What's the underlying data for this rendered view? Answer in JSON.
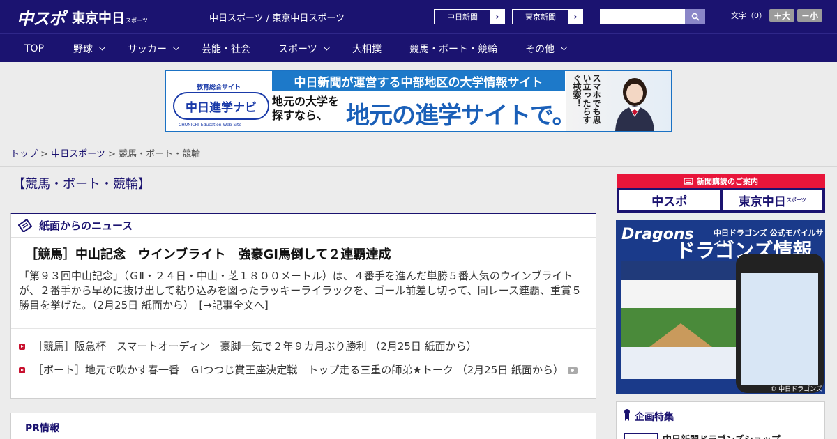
{
  "header": {
    "logo_main": "中スポ",
    "logo_sub": "東京中日",
    "logo_sub_small": "スポーツ",
    "tagline": "中日スポーツ / 東京中日スポーツ",
    "site_links": [
      {
        "label": "中日新聞"
      },
      {
        "label": "東京新聞"
      }
    ],
    "search_placeholder": "",
    "font_size_label": "文字（0）",
    "font_larger": "＋大",
    "font_smaller": "－小"
  },
  "nav": [
    {
      "label": "TOP",
      "has_dropdown": false
    },
    {
      "label": "野球",
      "has_dropdown": true
    },
    {
      "label": "サッカー",
      "has_dropdown": true
    },
    {
      "label": "芸能・社会",
      "has_dropdown": false
    },
    {
      "label": "スポーツ",
      "has_dropdown": true
    },
    {
      "label": "大相撲",
      "has_dropdown": false
    },
    {
      "label": "競馬・ボート・競輪",
      "has_dropdown": false
    },
    {
      "label": "その他",
      "has_dropdown": true
    }
  ],
  "ad_banner": {
    "brand_top": "教育総合サイト",
    "brand_name": "中日進学ナビ",
    "brand_en": "CHUNICHI Education Web Site",
    "headline": "中日新聞が運営する中部地区の大学情報サイト",
    "sub_line1": "地元の大学を",
    "sub_line2": "探すなら、",
    "big_text": "地元の進学サイトで。",
    "vertical_text": "スマホでも思い立ったらすぐ検索！"
  },
  "breadcrumb": {
    "home": "トップ",
    "section": "中日スポーツ",
    "current": "競馬・ボート・競輪",
    "separator": ">"
  },
  "page_title": "【競馬・ボート・競輪】",
  "news": {
    "heading": "紙面からのニュース",
    "lead": {
      "title": "［競馬］中山記念　ウインブライト　強豪GI馬倒して２連覇達成",
      "body": "「第９３回中山記念」（ＧⅡ・２４日・中山・芝１８００メートル）は、４番手を進んだ単勝５番人気のウインブライトが、２番手から早めに抜け出して粘り込みを図ったラッキーライラックを、ゴール前差し切って、同レース連覇、重賞５勝目を挙げた。（2月25日 紙面から）　[→記事全文へ]"
    },
    "items": [
      {
        "text": "［競馬］阪急杯　スマートオーディン　豪脚一気で２年９カ月ぶり勝利 （2月25日 紙面から）",
        "has_photo": false
      },
      {
        "text": "［ボート］地元で吹かす春一番　ＧⅠつつじ賞王座決定戦　トップ走る三重の師弟★トーク （2月25日 紙面から）",
        "has_photo": true
      }
    ]
  },
  "pr": {
    "heading": "PR情報"
  },
  "sidebar": {
    "subscribe_heading": "新聞購読のご案内",
    "subscribe_buttons": [
      {
        "label": "中スポ",
        "small": ""
      },
      {
        "label": "東京中日",
        "small": "スポーツ"
      }
    ],
    "dragons_ad": {
      "logo": "Dragons",
      "sub": "中日ドラゴンズ 公式モバイルサイト",
      "title": "ドラゴンズ情報",
      "footer": "© 中日ドラゴンズ"
    },
    "feature_heading": "企画特集",
    "feature_item": "中日新聞ドラゴンズショップ"
  },
  "colors": {
    "brand_navy": "#1b1370",
    "accent_red": "#e8153a",
    "banner_blue": "#1d79c9"
  }
}
